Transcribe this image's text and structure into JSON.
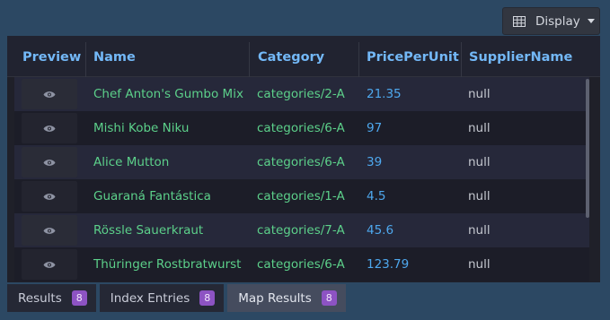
{
  "toolbar": {
    "display_label": "Display"
  },
  "columns": [
    "Preview",
    "Name",
    "Category",
    "PricePerUnit",
    "SupplierName"
  ],
  "rows": [
    {
      "name": "Chef Anton's Gumbo Mix",
      "category": "categories/2-A",
      "price": "21.35",
      "supplier": "null"
    },
    {
      "name": "Mishi Kobe Niku",
      "category": "categories/6-A",
      "price": "97",
      "supplier": "null"
    },
    {
      "name": "Alice Mutton",
      "category": "categories/6-A",
      "price": "39",
      "supplier": "null"
    },
    {
      "name": "Guaraná Fantástica",
      "category": "categories/1-A",
      "price": "4.5",
      "supplier": "null"
    },
    {
      "name": "Rössle Sauerkraut",
      "category": "categories/7-A",
      "price": "45.6",
      "supplier": "null"
    },
    {
      "name": "Thüringer Rostbratwurst",
      "category": "categories/6-A",
      "price": "123.79",
      "supplier": "null"
    }
  ],
  "tabs": [
    {
      "label": "Results",
      "count": "8",
      "active": false
    },
    {
      "label": "Index Entries",
      "count": "8",
      "active": false
    },
    {
      "label": "Map Results",
      "count": "8",
      "active": true
    }
  ],
  "colors": {
    "background": "#2c4863",
    "header_text": "#73b8f7",
    "name_text": "#5cd08a",
    "number_text": "#4ea8ee",
    "badge": "#8d53c3"
  },
  "icons": {
    "display": "table-grid-icon",
    "preview": "eye-icon",
    "dropdown": "caret-down-icon"
  }
}
